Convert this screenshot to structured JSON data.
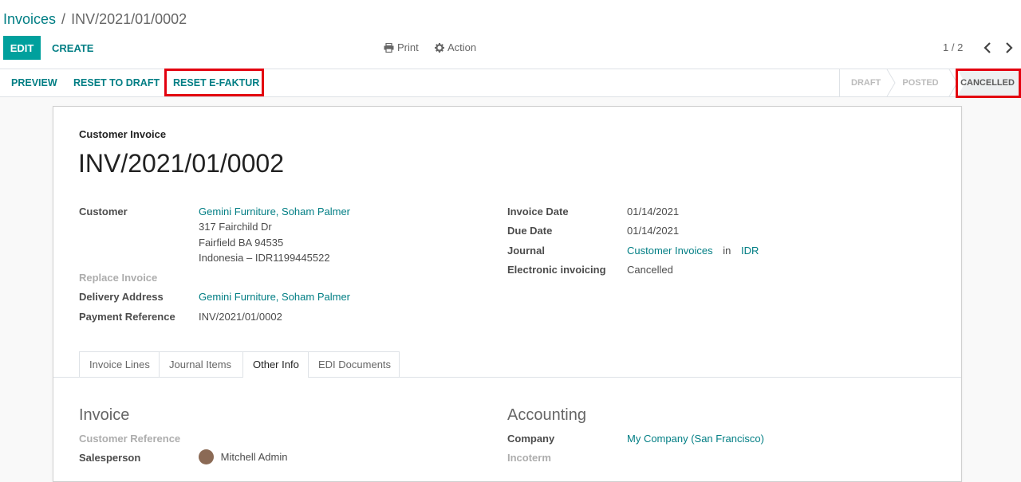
{
  "breadcrumb": {
    "parent": "Invoices",
    "separator": "/",
    "current": "INV/2021/01/0002"
  },
  "toolbar": {
    "edit_label": "EDIT",
    "create_label": "CREATE",
    "print_label": "Print",
    "action_label": "Action",
    "pager": "1 / 2"
  },
  "statusbar": {
    "buttons": [
      "PREVIEW",
      "RESET TO DRAFT",
      "RESET E-FAKTUR"
    ],
    "stages": [
      "DRAFT",
      "POSTED",
      "CANCELLED"
    ],
    "active_stage": "CANCELLED"
  },
  "invoice": {
    "type_label": "Customer Invoice",
    "number": "INV/2021/01/0002",
    "customer_label": "Customer",
    "customer_name": "Gemini Furniture, Soham Palmer",
    "address_line1": "317 Fairchild Dr",
    "address_line2": "Fairfield BA 94535",
    "address_line3": "Indonesia – IDR1199445522",
    "replace_invoice_label": "Replace Invoice",
    "delivery_label": "Delivery Address",
    "delivery_value": "Gemini Furniture, Soham Palmer",
    "payment_ref_label": "Payment Reference",
    "payment_ref_value": "INV/2021/01/0002",
    "invoice_date_label": "Invoice Date",
    "invoice_date_value": "01/14/2021",
    "due_date_label": "Due Date",
    "due_date_value": "01/14/2021",
    "journal_label": "Journal",
    "journal_value": "Customer Invoices",
    "journal_in": "in",
    "journal_currency": "IDR",
    "edi_label": "Electronic invoicing",
    "edi_value": "Cancelled"
  },
  "tabs": [
    "Invoice Lines",
    "Journal Items",
    "Other Info",
    "EDI Documents"
  ],
  "active_tab": "Other Info",
  "other_info": {
    "invoice_title": "Invoice",
    "customer_ref_label": "Customer Reference",
    "salesperson_label": "Salesperson",
    "salesperson_value": "Mitchell Admin",
    "accounting_title": "Accounting",
    "company_label": "Company",
    "company_value": "My Company (San Francisco)",
    "incoterm_label": "Incoterm"
  },
  "colors": {
    "primary": "#00a09d",
    "link": "#017e84",
    "highlight": "#e3000f"
  },
  "icons": [
    "print-icon",
    "gear-icon",
    "chevron-left-icon",
    "chevron-right-icon",
    "avatar"
  ]
}
